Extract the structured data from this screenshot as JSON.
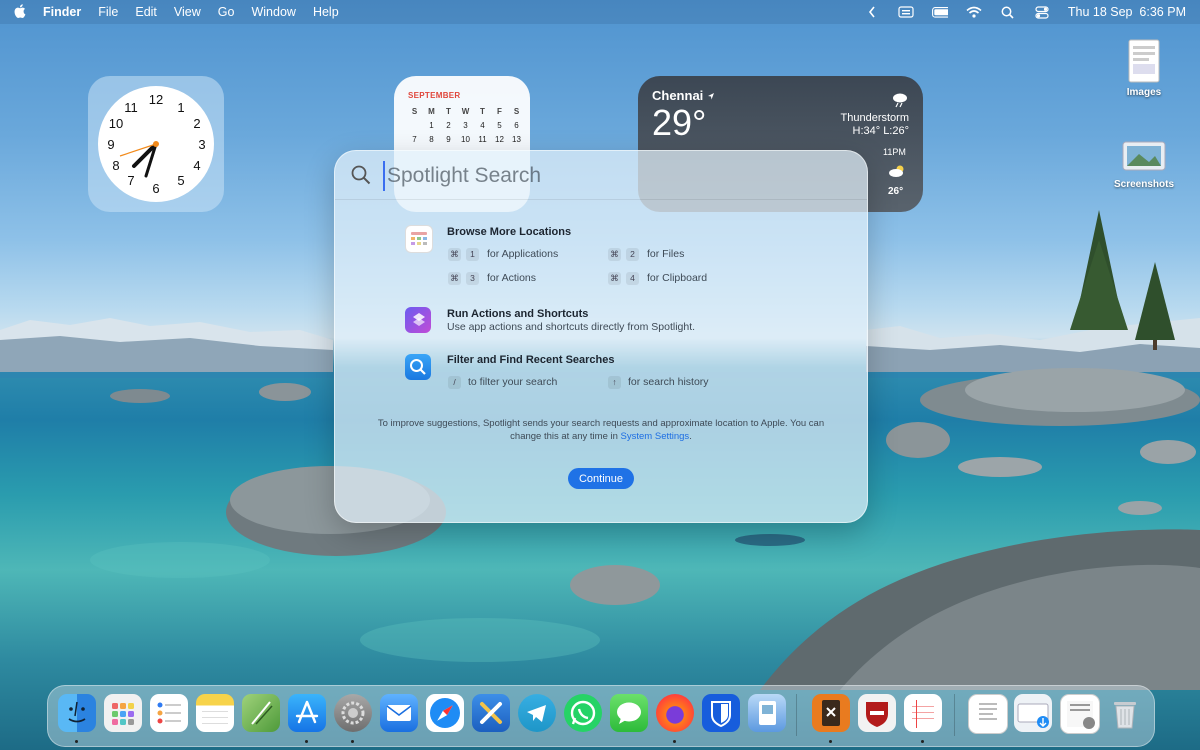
{
  "menubar": {
    "apple": "",
    "app_name": "Finder",
    "menus": [
      "File",
      "Edit",
      "View",
      "Go",
      "Window",
      "Help"
    ],
    "datetime": "Thu 18 Sep  6:36 PM"
  },
  "clock_widget": {
    "numbers": [
      "12",
      "1",
      "2",
      "3",
      "4",
      "5",
      "6",
      "7",
      "8",
      "9",
      "10",
      "11"
    ]
  },
  "calendar_widget": {
    "month": "SEPTEMBER",
    "weekdays": [
      "S",
      "M",
      "T",
      "W",
      "T",
      "F",
      "S"
    ],
    "rows": [
      [
        "",
        "1",
        "2",
        "3",
        "4",
        "5",
        "6"
      ],
      [
        "7",
        "8",
        "9",
        "10",
        "11",
        "12",
        "13"
      ]
    ]
  },
  "weather_widget": {
    "city": "Chennai",
    "temp": "29°",
    "condition": "Thunderstorm",
    "high_low": "H:34° L:26°",
    "hour_label": "11PM",
    "hour_temp": "26°"
  },
  "desktop": {
    "icons": [
      {
        "label": "Images"
      },
      {
        "label": "Screenshots"
      }
    ]
  },
  "spotlight": {
    "placeholder": "Spotlight Search",
    "browse": {
      "title": "Browse More Locations",
      "shortcuts": [
        {
          "key": "1",
          "label": "for Applications"
        },
        {
          "key": "2",
          "label": "for Files"
        },
        {
          "key": "3",
          "label": "for Actions"
        },
        {
          "key": "4",
          "label": "for Clipboard"
        }
      ],
      "cmd_symbol": "⌘"
    },
    "actions": {
      "title": "Run Actions and Shortcuts",
      "subtitle": "Use app actions and shortcuts directly from Spotlight."
    },
    "filter": {
      "title": "Filter and Find Recent Searches",
      "slash_key": "/",
      "slash_label": "to filter your search",
      "arrow_key": "↑",
      "arrow_label": "for search history"
    },
    "privacy_text": "To improve suggestions, Spotlight sends your search requests and approximate location to Apple. You can change this at any time in",
    "privacy_link": "System Settings",
    "privacy_end": ".",
    "continue_label": "Continue"
  },
  "dock": {
    "apps": [
      "Finder",
      "Launchpad",
      "Reminders",
      "Notes",
      "Script Editor",
      "App Store",
      "System Settings",
      "Mail",
      "Safari",
      "Xcode Tools",
      "Telegram",
      "WhatsApp",
      "Messages",
      "Firefox",
      "Bitwarden",
      "Preview",
      "Keka",
      "AdGuard",
      "Notebook",
      "Document",
      "Downloads",
      "Files",
      "Trash"
    ]
  },
  "colors": {
    "accent": "#1f72e6",
    "calendar_red": "#e0463b"
  }
}
